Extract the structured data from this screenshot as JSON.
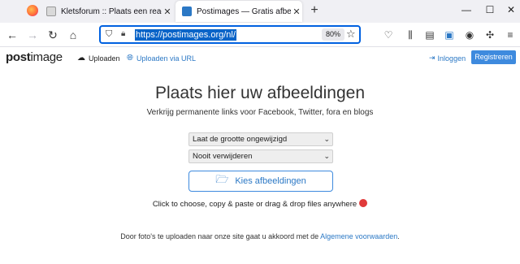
{
  "browser": {
    "tabs": [
      {
        "title": "Kletsforum :: Plaats een reactie",
        "active": false
      },
      {
        "title": "Postimages — Gratis afbeeldingen",
        "active": true
      }
    ],
    "new_tab_icon": "plus-icon",
    "url": "https://postimages.org/nl/",
    "zoom": "80%"
  },
  "site": {
    "logo_post": "post",
    "logo_image": "image",
    "nav": {
      "upload_label": "Uploaden",
      "upload_url_label": "Uploaden via URL",
      "login_label": "Inloggen",
      "register_label": "Registreren"
    },
    "headline": "Plaats hier uw afbeeldingen",
    "subline": "Verkrijg permanente links voor Facebook, Twitter, fora en blogs",
    "resize_select": "Laat de grootte ongewijzigd",
    "expire_select": "Nooit verwijderen",
    "choose_button": "Kies afbeeldingen",
    "hint": "Click to choose, copy & paste or drag & drop files anywhere",
    "terms_prefix": "Door foto's te uploaden naar onze site gaat u akkoord met de",
    "terms_link": "Algemene voorwaarden",
    "terms_suffix": "."
  },
  "colors": {
    "accent": "#3e8ade",
    "link": "#2b78c5",
    "url_highlight": "#0a64c8"
  }
}
